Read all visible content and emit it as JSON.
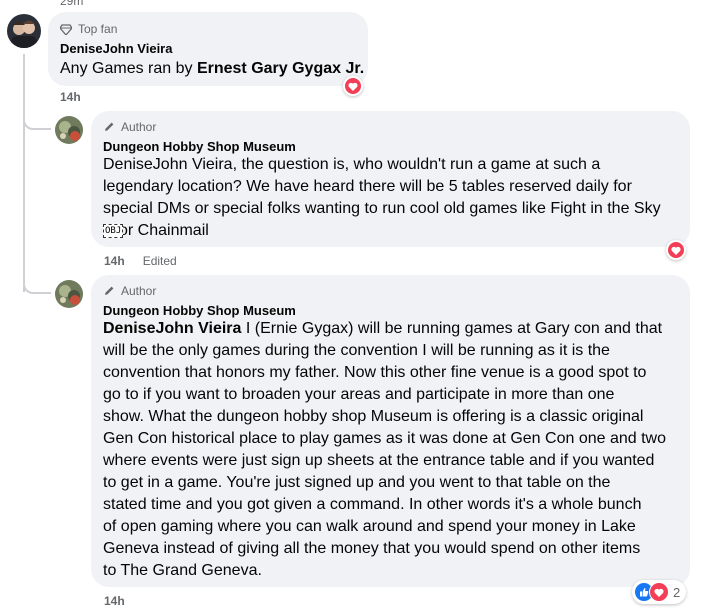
{
  "top_cut_text": "29m",
  "comments": [
    {
      "badge": "Top fan",
      "name": "DeniseJohn Vieira",
      "text_prefix": "Any Games ran by ",
      "text_bold": "Ernest Gary Gygax Jr.",
      "time": "14h",
      "reaction": "heart"
    },
    {
      "badge": "Author",
      "name": "Dungeon Hobby Shop Museum",
      "text_lines": [
        "DeniseJohn Vieira, the question is, who wouldn't run a game at such a",
        "legendary location? We have heard there will be 5 tables reserved daily for",
        "special DMs or special folks wanting to run cool old games like Fight in the Sky",
        "or Chainmail"
      ],
      "obj_mark": "OBJ",
      "time": "14h",
      "edited": "Edited",
      "reaction": "heart"
    },
    {
      "badge": "Author",
      "name": "Dungeon Hobby Shop Museum",
      "mention": "DeniseJohn Vieira",
      "text_lines": [
        " I (Ernie Gygax) will be running games at Gary con and that",
        "will be the only games during the convention I will be running as it is the",
        "convention that honors my father. Now this other fine venue is a good spot to",
        "go to if you want to broaden your areas and participate in more than one",
        "show. What the dungeon hobby shop Museum is offering is a classic original",
        "Gen Con historical place to play games as it was done at Gen Con one and two",
        "where events were just sign up sheets at the entrance table and if you wanted",
        "to get in a game. You're just signed up and you went to that table on the",
        "stated time and you got given a command. In other words it's a whole bunch",
        "of open gaming where you can walk around and spend your money in Lake",
        "Geneva instead of giving all the money that you would spend on other items",
        "to The Grand Geneva."
      ],
      "time": "14h",
      "reactions": [
        "like",
        "heart"
      ],
      "reaction_count": "2"
    }
  ],
  "colors": {
    "bubble": "#f0f2f5",
    "like": "#1877f2",
    "heart": "#f33e58",
    "muted": "#65676b"
  }
}
